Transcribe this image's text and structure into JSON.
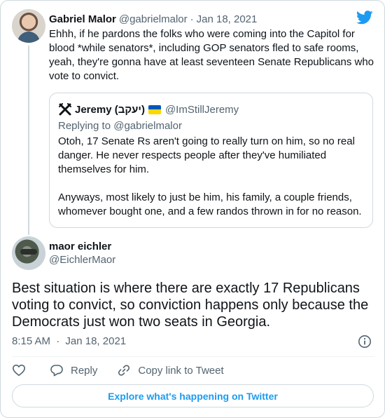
{
  "parent_tweet": {
    "author_name": "Gabriel Malor",
    "handle": "@gabrielmalor",
    "date": "Jan 18, 2021",
    "separator": "·",
    "text": "Ehhh, if he pardons the folks who were coming into the Capitol for blood *while senators*, including GOP senators fled to safe rooms, yeah, they're gonna have at least seventeen Senate Republicans who vote to convict.",
    "avatar_icon": "profile-photo",
    "brand_icon": "twitter-bird-icon",
    "brand_color": "#1d9bf0"
  },
  "quoted_tweet": {
    "avatar_icon": "crossed-swords-icon",
    "author_name": "Jeremy (יעקב)",
    "flag_icon": "ukraine-flag",
    "handle": "@ImStillJeremy",
    "replying_to": "Replying to @gabrielmalor",
    "paragraphs": [
      "Otoh, 17 Senate Rs aren't going to really turn on him, so no real danger. He never respects people after they've humiliated themselves for him.",
      "Anyways, most likely to just be him, his family, a couple friends, whomever bought one, and a few randos thrown in for no reason."
    ]
  },
  "main_tweet": {
    "author_name": "maor eichler",
    "handle": "@EichlerMaor",
    "text": "Best situation is where there are exactly 17 Republicans voting to convict, so conviction happens only because the Democrats just won two seats in Georgia.",
    "time": "8:15 AM",
    "separator": "·",
    "date": "Jan 18, 2021",
    "avatar_icon": "profile-photo",
    "info_icon": "info-icon"
  },
  "actions": {
    "like_icon": "heart-icon",
    "reply_icon": "reply-bubble-icon",
    "reply_label": "Reply",
    "copy_icon": "link-icon",
    "copy_label": "Copy link to Tweet"
  },
  "explore_button": {
    "label": "Explore what's happening on Twitter",
    "color": "#1d9bf0"
  }
}
